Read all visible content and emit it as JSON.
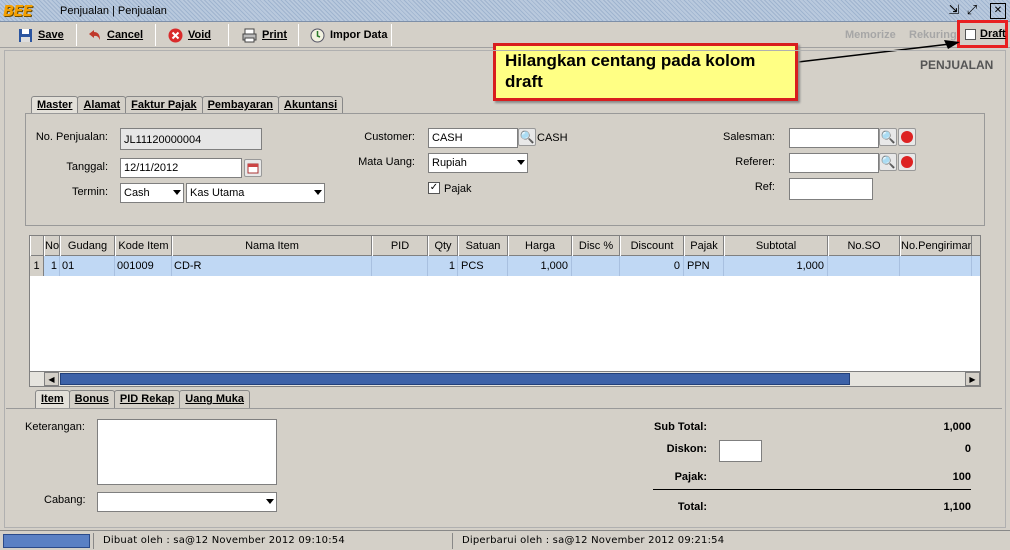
{
  "window": {
    "title": "Penjualan | Penjualan",
    "logo": "BEE",
    "minimize": "⇲",
    "maximize": "⤢",
    "close": "✕"
  },
  "toolbar": {
    "save": "Save",
    "cancel": "Cancel",
    "void": "Void",
    "print": "Print",
    "import": "Impor Data",
    "memorize": "Memorize",
    "rekuring": "Rekuring",
    "draft": "Draft",
    "draft_checked": false
  },
  "callout": {
    "text": "Hilangkan centang pada kolom draft"
  },
  "page_header": "PENJUALAN",
  "tabs": [
    "Master",
    "Alamat",
    "Faktur Pajak",
    "Pembayaran",
    "Akuntansi"
  ],
  "master": {
    "no_penjualan_label": "No. Penjualan:",
    "no_penjualan": "JL11120000004",
    "tanggal_label": "Tanggal:",
    "tanggal": "12/11/2012",
    "termin_label": "Termin:",
    "termin": "Cash",
    "kas": "Kas Utama",
    "customer_label": "Customer:",
    "customer": "CASH",
    "customer_name": "CASH",
    "mata_uang_label": "Mata Uang:",
    "mata_uang": "Rupiah",
    "pajak_label": "Pajak",
    "pajak_checked": true,
    "salesman_label": "Salesman:",
    "salesman": "",
    "referer_label": "Referer:",
    "referer": "",
    "ref_label": "Ref:",
    "ref": ""
  },
  "grid": {
    "columns": [
      "No",
      "Gudang",
      "Kode Item",
      "Nama Item",
      "PID",
      "Qty",
      "Satuan",
      "Harga",
      "Disc %",
      "Discount",
      "Pajak",
      "Subtotal",
      "No.SO",
      "No.Pengiriman"
    ],
    "rows": [
      {
        "rownum": "1",
        "no": "1",
        "gudang": "01",
        "kode": "001009",
        "nama": "CD-R",
        "pid": "",
        "qty": "1",
        "satuan": "PCS",
        "harga": "1,000",
        "disc": "",
        "discount": "0",
        "pajak": "PPN",
        "subtotal": "1,000",
        "so": "",
        "pengiriman": ""
      }
    ]
  },
  "bottom_tabs": [
    "Item",
    "Bonus",
    "PID Rekap",
    "Uang Muka"
  ],
  "bottom": {
    "keterangan_label": "Keterangan:",
    "keterangan": "",
    "cabang_label": "Cabang:",
    "cabang": ""
  },
  "totals": {
    "sub_total_label": "Sub Total:",
    "sub_total": "1,000",
    "diskon_label": "Diskon:",
    "diskon_input": "",
    "diskon": "0",
    "pajak_label": "Pajak:",
    "pajak": "100",
    "total_label": "Total:",
    "total": "1,100"
  },
  "status": {
    "dibuat": "Dibuat oleh : sa@12 November 2012  09:10:54",
    "diperbarui": "Diperbarui oleh : sa@12 November 2012  09:21:54"
  },
  "colors": {
    "accent": "#3d62a8",
    "callout_bg": "#ffff84",
    "highlight_border": "#e82020",
    "row_selected": "#c0d8f4"
  }
}
